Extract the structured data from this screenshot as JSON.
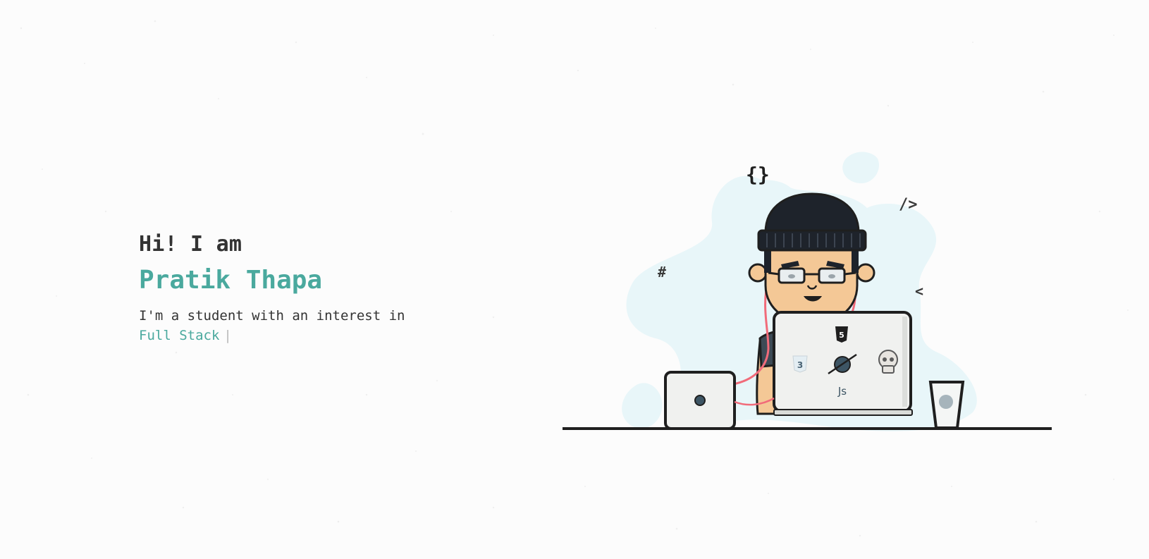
{
  "hero": {
    "greeting": "Hi! I am",
    "name": "Pratik Thapa",
    "intro": "I'm a student with an interest in",
    "interest": "Full Stack",
    "cursor": "|"
  },
  "illustration": {
    "icons": [
      "curly-braces-icon",
      "code-slash-icon",
      "hash-icon",
      "angle-bracket-icon",
      "html5-icon",
      "css3-icon",
      "planet-sticker-icon",
      "skull-sticker-icon"
    ],
    "laptop_sticker_text": "Js",
    "symbols": {
      "braces": "{}",
      "slash": "/>",
      "hash": "#",
      "angle": "<"
    },
    "colors": {
      "blob": "#e8f6f9",
      "outline": "#1f1f1f",
      "skin": "#f4c896",
      "beanie": "#1e232b",
      "laptop": "#f0f1ef",
      "earphone": "#f16b7a"
    }
  },
  "colors": {
    "accent": "#4aa99e",
    "text": "#333333",
    "background": "#fcfcfc"
  }
}
